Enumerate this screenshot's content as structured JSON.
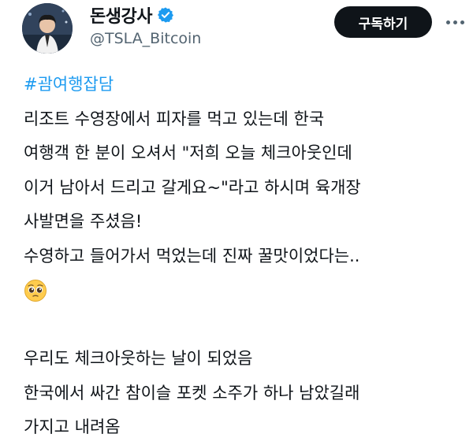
{
  "user": {
    "display_name": "돈생강사",
    "handle": "@TSLA_Bitcoin",
    "verified_icon": "verified-badge-icon",
    "avatar_icon": "profile-avatar"
  },
  "actions": {
    "subscribe_label": "구독하기"
  },
  "tweet": {
    "hashtag": "#괌여행잡담",
    "lines": [
      "리조트 수영장에서 피자를 먹고 있는데 한국",
      "여행객 한 분이 오셔서 \"저희 오늘 체크아웃인데",
      "이거 남아서 드리고 갈게요~\"라고 하시며 육개장",
      "사발면을 주셨음!",
      "수영하고 들어가서 먹었는데 진짜 꿀맛이었다는.."
    ],
    "emoji": "pleading-face-emoji",
    "lines2": [
      "우리도 체크아웃하는 날이 되었음",
      "한국에서 싸간 참이슬 포켓 소주가 하나 남았길래",
      "가지고 내려옴"
    ]
  },
  "colors": {
    "accent": "#1d9bf0",
    "text": "#0f1419",
    "secondary": "#536471",
    "button_bg": "#0f1419"
  }
}
